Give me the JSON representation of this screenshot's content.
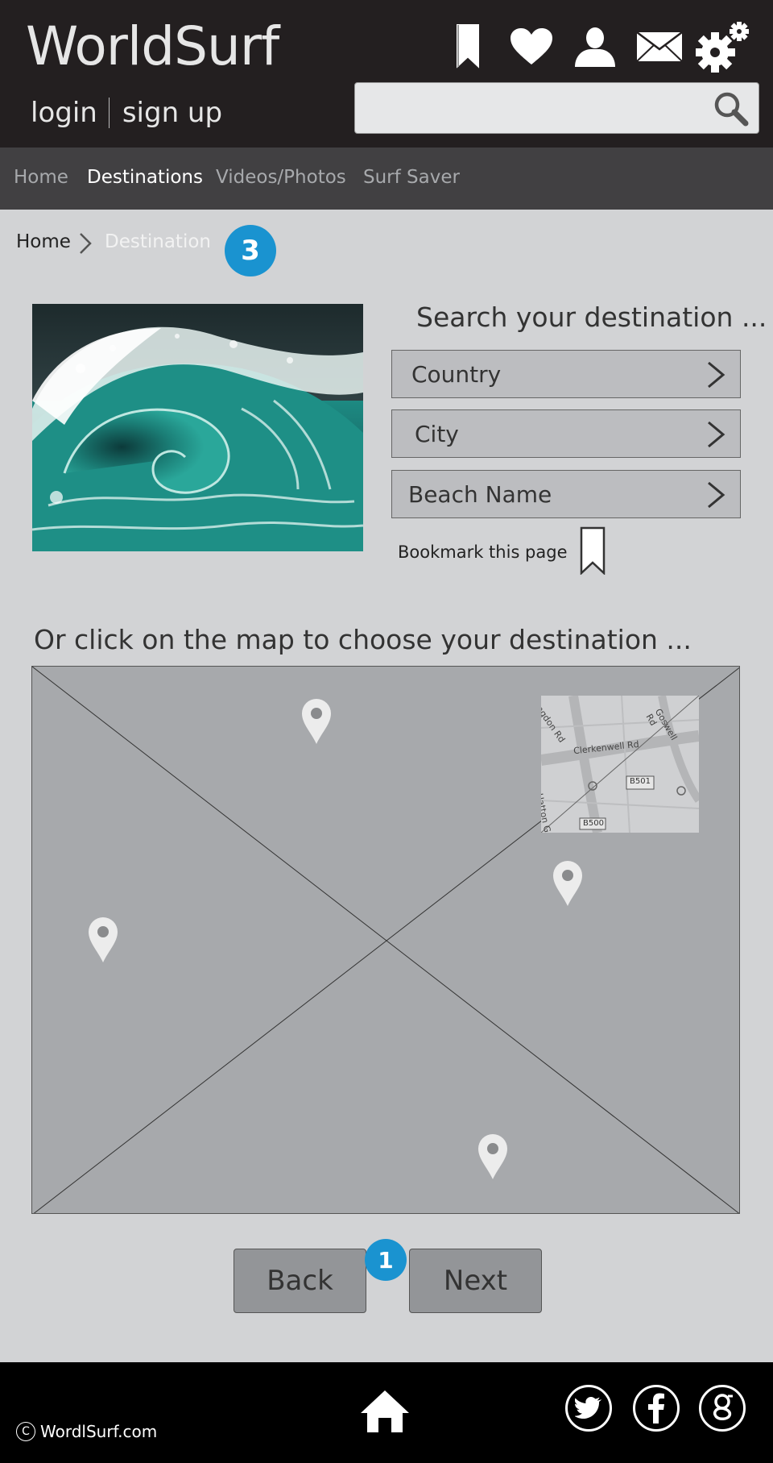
{
  "header": {
    "logo": "WorldSurf",
    "login": "login",
    "signup": "sign up",
    "icons": [
      "bookmark-icon",
      "heart-icon",
      "user-icon",
      "mail-icon",
      "settings-icon"
    ],
    "search_placeholder": ""
  },
  "nav": {
    "items": [
      {
        "label": "Home",
        "active": false
      },
      {
        "label": "Destinations",
        "active": true
      },
      {
        "label": "Videos/Photos",
        "active": false
      },
      {
        "label": "Surf Saver",
        "active": false
      }
    ]
  },
  "breadcrumb": {
    "home": "Home",
    "current": "Destination",
    "step_badge": "3"
  },
  "search_panel": {
    "title": "Search your destination  ...",
    "country": "Country",
    "city": "City",
    "beach": "Beach Name",
    "bookmark_label": "Bookmark this page"
  },
  "map": {
    "title": "Or click on the map to choose your destination ...",
    "inset_labels": [
      "Clerkenwell Rd",
      "Hatton Garden",
      "B501",
      "B500",
      "Goswell Rd",
      "ngdon Rd"
    ]
  },
  "actions": {
    "back": "Back",
    "next": "Next",
    "step_badge": "1"
  },
  "footer": {
    "copyright": "WordlSurf.com",
    "social": [
      "twitter-icon",
      "facebook-icon",
      "google-icon"
    ]
  },
  "colors": {
    "header_bg": "#231f20",
    "nav_bg": "#414042",
    "page_bg": "#d2d3d5",
    "badge": "#1a93d0",
    "footer_bg": "#000000"
  }
}
